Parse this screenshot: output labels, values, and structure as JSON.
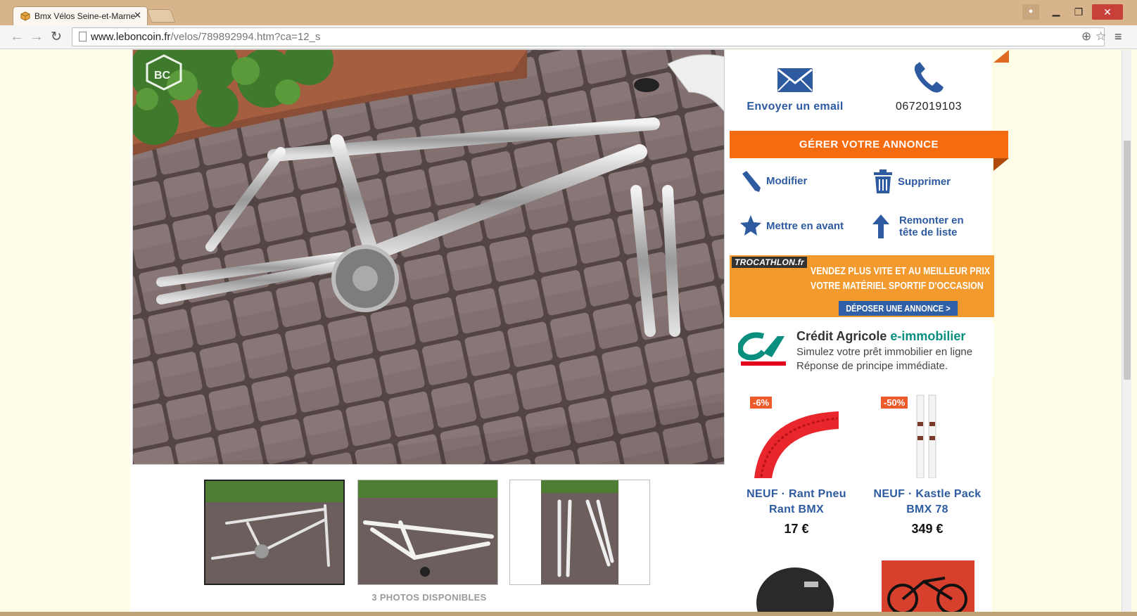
{
  "browser": {
    "tab_title": "Bmx Vélos Seine-et-Marne",
    "tab_close": "✕",
    "url_host": "www.leboncoin.fr",
    "url_path": "/velos/789892994.htm?ca=12_s"
  },
  "listing": {
    "photos_count": "3 PHOTOS DISPONIBLES"
  },
  "contact": {
    "email_label": "Envoyer un email",
    "phone": "0672019103"
  },
  "manage": {
    "title": "GÉRER VOTRE ANNONCE",
    "modify": "Modifier",
    "delete": "Supprimer",
    "promote": "Mettre en avant",
    "bump_line1": "Remonter en",
    "bump_line2": "tête de liste"
  },
  "ads": {
    "trocathlon": {
      "brand": "TROCATHLON.fr",
      "line1": "VENDEZ PLUS VITE ET AU MEILLEUR PRIX",
      "line2": "VOTRE MATÉRIEL SPORTIF D'OCCASION",
      "cta": "DÉPOSER UNE ANNONCE >"
    },
    "credit_agricole": {
      "title_main": "Crédit Agricole ",
      "title_accent": "e-immobilier",
      "line1": "Simulez votre prêt immobilier en ligne",
      "line2": "Réponse de principe immédiate."
    }
  },
  "products": [
    {
      "discount": "-6%",
      "name_line1": "NEUF · Rant Pneu",
      "name_line2": "Rant BMX",
      "price": "17 €"
    },
    {
      "discount": "-50%",
      "name_line1": "NEUF · Kastle Pack",
      "name_line2": "BMX 78",
      "price": "349 €"
    }
  ],
  "colors": {
    "orange": "#f56b0f",
    "link_blue": "#2e5aa0",
    "title_bar": "#d8b48c"
  }
}
